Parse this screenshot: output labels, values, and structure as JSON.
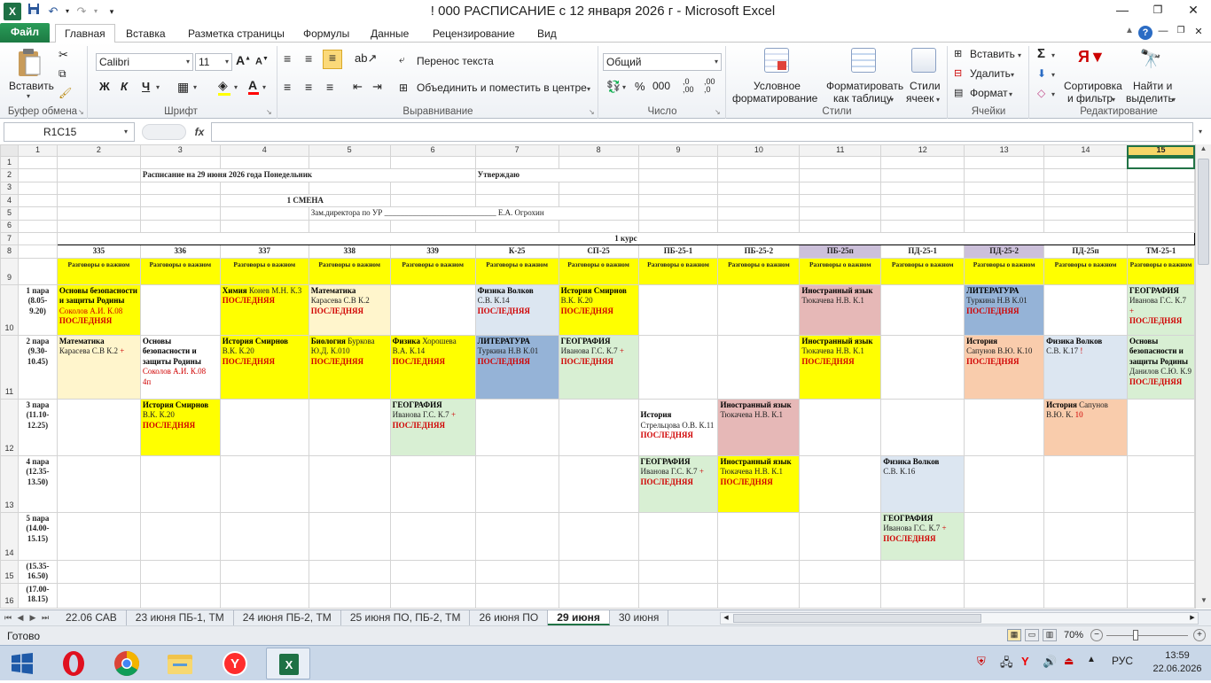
{
  "window": {
    "title": "! 000 РАСПИСАНИЕ с 12 января 2026 г  -  Microsoft Excel",
    "qat_icons": [
      "excel-logo-icon",
      "save-icon",
      "undo-icon",
      "redo-icon",
      "customize-qat-icon"
    ]
  },
  "menu": {
    "file": "Файл",
    "tabs": [
      "Главная",
      "Вставка",
      "Разметка страницы",
      "Формулы",
      "Данные",
      "Рецензирование",
      "Вид"
    ],
    "active": "Главная"
  },
  "ribbon": {
    "clipboard": {
      "paste": "Вставить",
      "group": "Буфер обмена"
    },
    "font": {
      "name": "Calibri",
      "size": "11",
      "bold": "Ж",
      "italic": "К",
      "underline": "Ч",
      "group": "Шрифт"
    },
    "alignment": {
      "wrap": "Перенос текста",
      "merge": "Объединить и поместить в центре",
      "group": "Выравнивание"
    },
    "number": {
      "format": "Общий",
      "group": "Число"
    },
    "styles": {
      "conditional1": "Условное",
      "conditional2": "форматирование",
      "table1": "Форматировать",
      "table2": "как таблицу",
      "cell1": "Стили",
      "cell2": "ячеек",
      "group": "Стили"
    },
    "cells": {
      "insert": "Вставить",
      "delete": "Удалить",
      "format": "Формат",
      "group": "Ячейки"
    },
    "editing": {
      "sort1": "Сортировка",
      "sort2": "и фильтр",
      "find1": "Найти и",
      "find2": "выделить",
      "group": "Редактирование"
    }
  },
  "formula_bar": {
    "name_box": "R1C15",
    "fx": "fx",
    "value": ""
  },
  "sheet": {
    "col_headers": [
      "1",
      "2",
      "3",
      "4",
      "5",
      "6",
      "7",
      "8",
      "9",
      "10",
      "11",
      "12",
      "13",
      "14",
      "15"
    ],
    "header_title": "Расписание на 29 июня 2026 года  Понедельник",
    "approve": "Утверждаю",
    "shift": "1 СМЕНА",
    "deputy": "Зам.директора по УР",
    "deputy_line": "____________________________",
    "deputy_name": "Е.А. Огрохин",
    "course": "1 курс",
    "groups": [
      "335",
      "336",
      "337",
      "338",
      "339",
      "К-25",
      "СП-25",
      "ПБ-25-1",
      "ПБ-25-2",
      "ПБ-25п",
      "ПД-25-1",
      "ПД-25-2",
      "ПД-25п",
      "ТМ-25-1"
    ],
    "talks": "Разговоры о важном",
    "periods": [
      {
        "name": "1 пара",
        "time": "(8.05-",
        "time2": "9.20)"
      },
      {
        "name": "2 пара",
        "time": "(9.30-",
        "time2": "10.45)"
      },
      {
        "name": "3 пара",
        "time": "(11.10-",
        "time2": "12.25)"
      },
      {
        "name": "4 пара",
        "time": "(12.35-",
        "time2": "13.50)"
      },
      {
        "name": "5 пара",
        "time": "(14.00-",
        "time2": "15.15)"
      },
      {
        "name": "",
        "time": "(15.35-",
        "time2": "16.50)"
      },
      {
        "name": "",
        "time": "(17.00-",
        "time2": "18.15)"
      }
    ],
    "last": "ПОСЛЕДНЯЯ",
    "cells": {
      "p1_c2_subj": "Основы безопасности и защиты Родины",
      "p1_c2_teacher": "Соколов А.И. К.08",
      "p1_c4_subj": "Химия",
      "p1_c4_teacher": "Конев М.Н. К.3",
      "p1_c5_subj": "Математика",
      "p1_c5_teacher": "Карасева С.В К.2",
      "p1_c7_subj": "Физика  Волков",
      "p1_c7_teacher": "С.В. К.14",
      "p1_c8_subj": "История Смирнов",
      "p1_c8_teacher": "В.К. К.20",
      "p1_c11_subj": "Иностранный язык",
      "p1_c11_teacher": "Тюкачева Н.В. К.1",
      "p1_c13_subj": "ЛИТЕРАТУРА",
      "p1_c13_teacher": "Туркина Н.В К.01",
      "p1_c15_subj": "ГЕОГРАФИЯ",
      "p1_c15_teacher": "Иванова Г.С. К.7",
      "p2_c2_subj": "Математика",
      "p2_c2_teacher": "Карасева С.В К.2",
      "p2_c3_subj": "Основы безопасности и защиты Родины",
      "p2_c3_teacher": "Соколов А.И. К.08",
      "p2_c3_extra": "4п",
      "p2_c4_subj": "История Смирнов",
      "p2_c4_teacher": "В.К. К.20",
      "p2_c5_subj": "Биология",
      "p2_c5_teacher": "Буркова Ю.Д. К.010",
      "p2_c6_subj": "Физика",
      "p2_c6_teacher": "Хорошева В.А. К.14",
      "p2_c7_subj": "ЛИТЕРАТУРА",
      "p2_c7_teacher": "Туркина Н.В К.01",
      "p2_c8_subj": "ГЕОГРАФИЯ",
      "p2_c8_teacher": "Иванова Г.С. К.7",
      "p2_c11_subj": "Иностранный язык",
      "p2_c11_teacher": "Тюкачева Н.В. К.1",
      "p2_c13_subj": "История",
      "p2_c13_teacher": "Сапунов В.Ю. К.10",
      "p2_c14_subj": "Физика  Волков",
      "p2_c14_teacher": "С.В. К.17",
      "p2_c15_subj": "Основы безопасности и защиты Родины",
      "p2_c15_teacher": "Данилов С.Ю. К.9",
      "p3_c3_subj": "История Смирнов",
      "p3_c3_teacher": "В.К. К.20",
      "p3_c6_subj": "ГЕОГРАФИЯ",
      "p3_c6_teacher": "Иванова Г.С. К.7",
      "p3_c9_subj": "История",
      "p3_c9_teacher": "Стрельцова О.В. К.11",
      "p3_c10_subj": "Иностранный язык",
      "p3_c10_teacher": "Тюкачева Н.В. К.1",
      "p3_c14_subj": "История",
      "p3_c14_teacher": "Сапунов В.Ю. К.",
      "p3_c14_room": "10",
      "p4_c9_subj": "ГЕОГРАФИЯ",
      "p4_c9_teacher": "Иванова Г.С. К.7",
      "p4_c10_subj": "Иностранный язык",
      "p4_c10_teacher": "Тюкачева Н.В. К.1",
      "p4_c12_subj": "Физика  Волков",
      "p4_c12_teacher": "С.В. К.16",
      "p5_c12_subj": "ГЕОГРАФИЯ",
      "p5_c12_teacher": "Иванова Г.С. К.7"
    }
  },
  "sheet_tabs": [
    "22.06 САВ",
    "23 июня ПБ-1, ТМ",
    "24 июня ПБ-2, ТМ",
    "25 июня ПО, ПБ-2, ТМ",
    "26 июня ПО",
    "29 июня",
    "30 июня"
  ],
  "active_sheet": "29 июня",
  "status": {
    "ready": "Готово",
    "zoom": "70%"
  },
  "taskbar": {
    "lang": "РУС",
    "time": "13:59",
    "date": "22.06.2026"
  },
  "colors": {
    "excel_green": "#217346",
    "yellow": "#ffff00",
    "last_red": "#d00000",
    "selected_header": "#f7d667"
  }
}
